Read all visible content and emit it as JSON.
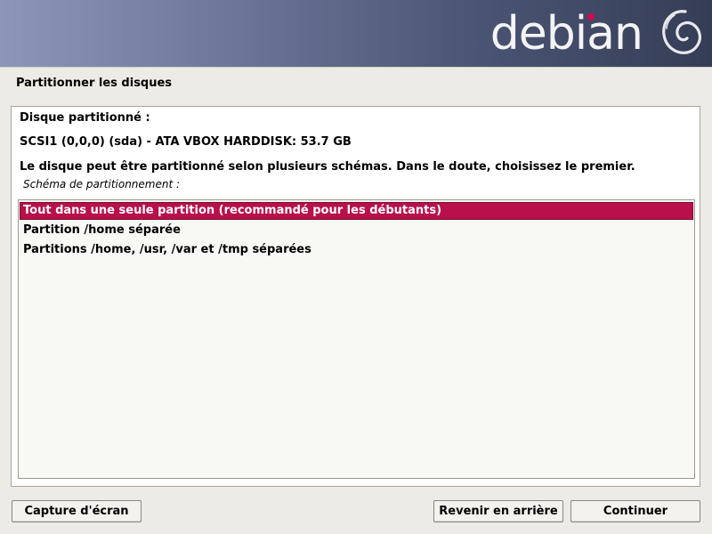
{
  "banner": {
    "logo_text": "debian",
    "logo_icon": "debian-swirl-icon",
    "accent": "#d70751"
  },
  "page": {
    "title": "Partitionner les disques"
  },
  "disk": {
    "heading": "Disque partitionné :",
    "name": "SCSI1 (0,0,0) (sda) - ATA VBOX HARDDISK: 53.7 GB",
    "description": "Le disque peut être partitionné selon plusieurs schémas. Dans le doute, choisissez le premier.",
    "list_label": "Schéma de partitionnement :"
  },
  "scheme_options": [
    "Tout dans une seule partition (recommandé pour les débutants)",
    "Partition /home séparée",
    "Partitions /home, /usr, /var et /tmp séparées"
  ],
  "selected_option": "Tout dans une seule partition (recommandé pour les débutants)",
  "colors": {
    "selection": "#b90f4a",
    "background": "#edebe5"
  },
  "buttons": {
    "screenshot": "Capture d'écran",
    "back": "Revenir en arrière",
    "continue": "Continuer"
  }
}
